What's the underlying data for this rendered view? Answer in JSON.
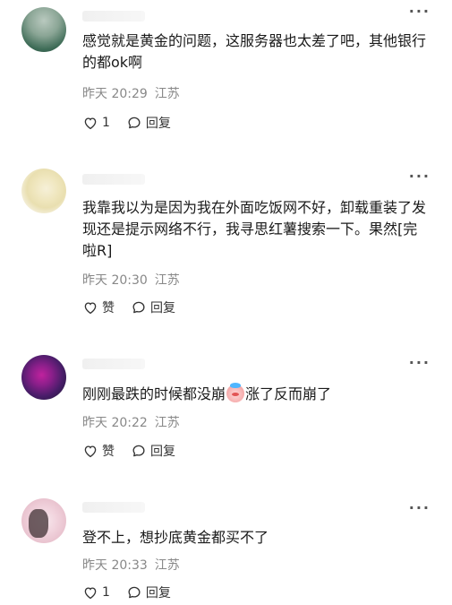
{
  "comments": [
    {
      "text": "感觉就是黄金的问题，这服务器也太差了吧，其他银行的都ok啊",
      "time": "昨天 20:29",
      "location": "江苏",
      "like_label": "1",
      "reply_label": "回复"
    },
    {
      "text": "我靠我以为是因为我在外面吃饭网不好，卸载重装了发现还是提示网络不行，我寻思红薯搜索一下。果然[完啦R]",
      "time": "昨天 20:30",
      "location": "江苏",
      "like_label": "赞",
      "reply_label": "回复"
    },
    {
      "text_before": "刚刚最跌的时候都没崩",
      "text_after": "涨了反而崩了",
      "time": "昨天 20:22",
      "location": "江苏",
      "like_label": "赞",
      "reply_label": "回复"
    },
    {
      "text": "登不上，想抄底黄金都买不了",
      "time": "昨天 20:33",
      "location": "江苏",
      "like_label": "1",
      "reply_label": "回复"
    }
  ],
  "icons": {
    "more": "more-icon",
    "like": "heart-icon",
    "reply": "chat-bubble-icon",
    "emoji": "clown-face-emoji"
  },
  "colors": {
    "text": "#1a1a1a",
    "meta": "#888888"
  }
}
